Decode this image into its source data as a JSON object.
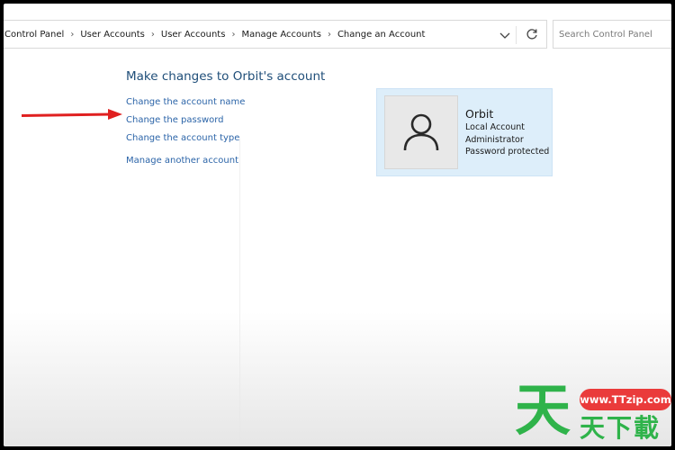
{
  "breadcrumb": {
    "items": [
      "Control Panel",
      "User Accounts",
      "User Accounts",
      "Manage Accounts",
      "Change an Account"
    ]
  },
  "search": {
    "placeholder": "Search Control Panel"
  },
  "page": {
    "heading": "Make changes to Orbit's account"
  },
  "tasks": [
    "Change the account name",
    "Change the password",
    "Change the account type",
    "Manage another account"
  ],
  "account": {
    "name": "Orbit",
    "details": [
      "Local Account",
      "Administrator",
      "Password protected"
    ]
  },
  "annotation": {
    "arrow_color": "#e02020"
  },
  "colors": {
    "link": "#2b64a8",
    "heading": "#1f4e79",
    "card_bg": "#ddeefa"
  },
  "icons": {
    "dropdown": "chevron-down-icon",
    "refresh": "refresh-icon",
    "avatar": "user-icon"
  },
  "watermark": {
    "url": "www.TTzip.com",
    "big_char": "天",
    "small_chars": "天下載"
  }
}
